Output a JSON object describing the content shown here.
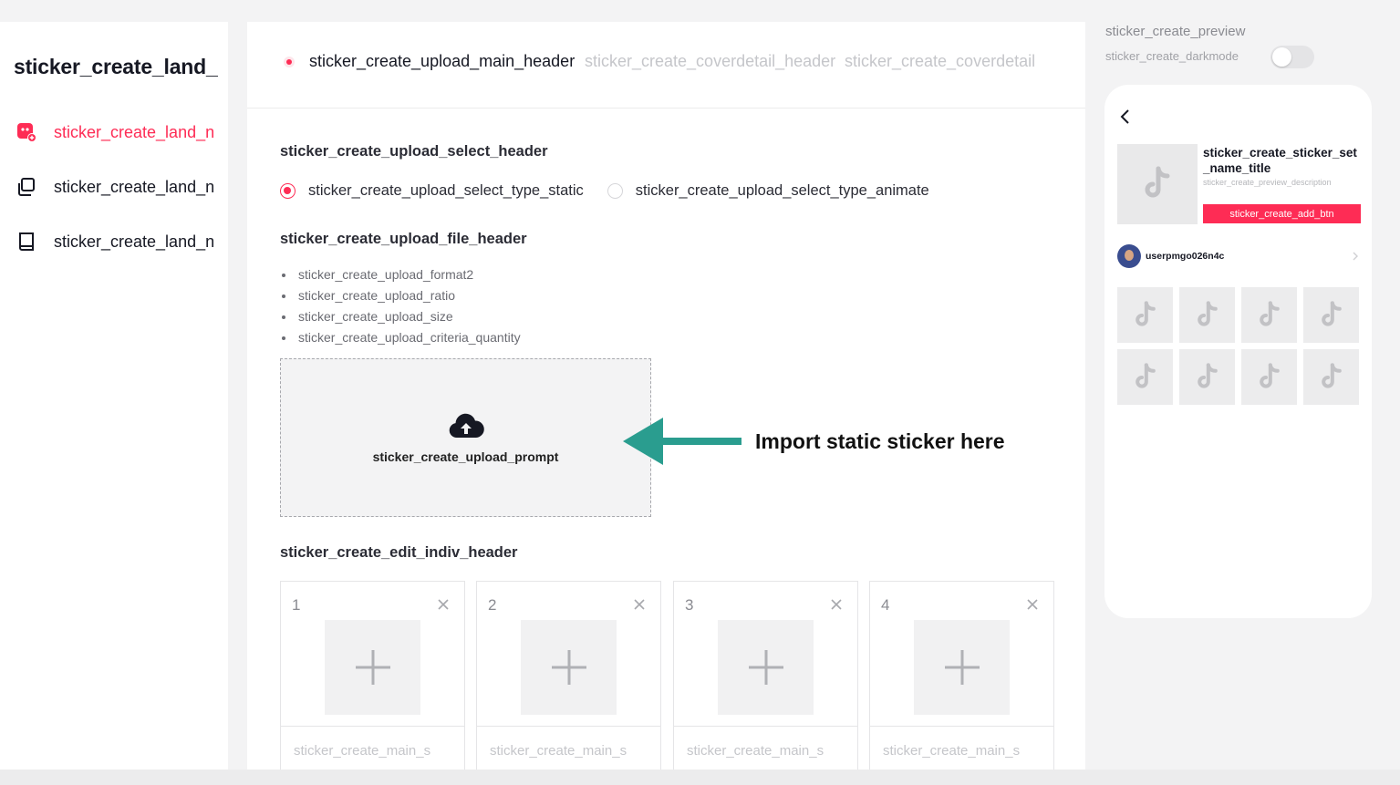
{
  "sidebar": {
    "title": "sticker_create_land_",
    "items": [
      {
        "label": "sticker_create_land_n",
        "icon": "sticker-icon",
        "active": true
      },
      {
        "label": "sticker_create_land_n",
        "icon": "copy-icon",
        "active": false
      },
      {
        "label": "sticker_create_land_n",
        "icon": "book-icon",
        "active": false
      }
    ]
  },
  "steps": {
    "main": "sticker_create_upload_main_header",
    "cover_detail_header": "sticker_create_coverdetail_header",
    "cover_detail": "sticker_create_coverdetail"
  },
  "select": {
    "header": "sticker_create_upload_select_header",
    "option_static": "sticker_create_upload_select_type_static",
    "option_animate": "sticker_create_upload_select_type_animate",
    "selected": "static"
  },
  "file": {
    "header": "sticker_create_upload_file_header",
    "criteria": [
      "sticker_create_upload_format2",
      "sticker_create_upload_ratio",
      "sticker_create_upload_size",
      "sticker_create_upload_criteria_quantity"
    ],
    "prompt": "sticker_create_upload_prompt"
  },
  "annotation": {
    "text": "Import static sticker here",
    "color": "#2a9d8f"
  },
  "edit": {
    "header": "sticker_create_edit_indiv_header",
    "slots": [
      {
        "number": "1",
        "caption": "sticker_create_main_s"
      },
      {
        "number": "2",
        "caption": "sticker_create_main_s"
      },
      {
        "number": "3",
        "caption": "sticker_create_main_s"
      },
      {
        "number": "4",
        "caption": "sticker_create_main_s"
      }
    ]
  },
  "preview": {
    "title": "sticker_create_preview",
    "darkmode_label": "sticker_create_darkmode",
    "darkmode_on": false,
    "set_title": "sticker_create_sticker_set_name_title",
    "description": "sticker_create_preview_description",
    "add_button": "sticker_create_add_btn",
    "username": "userpmgo026n4c"
  },
  "colors": {
    "accent": "#fe2c55",
    "annotation": "#2a9d8f"
  }
}
